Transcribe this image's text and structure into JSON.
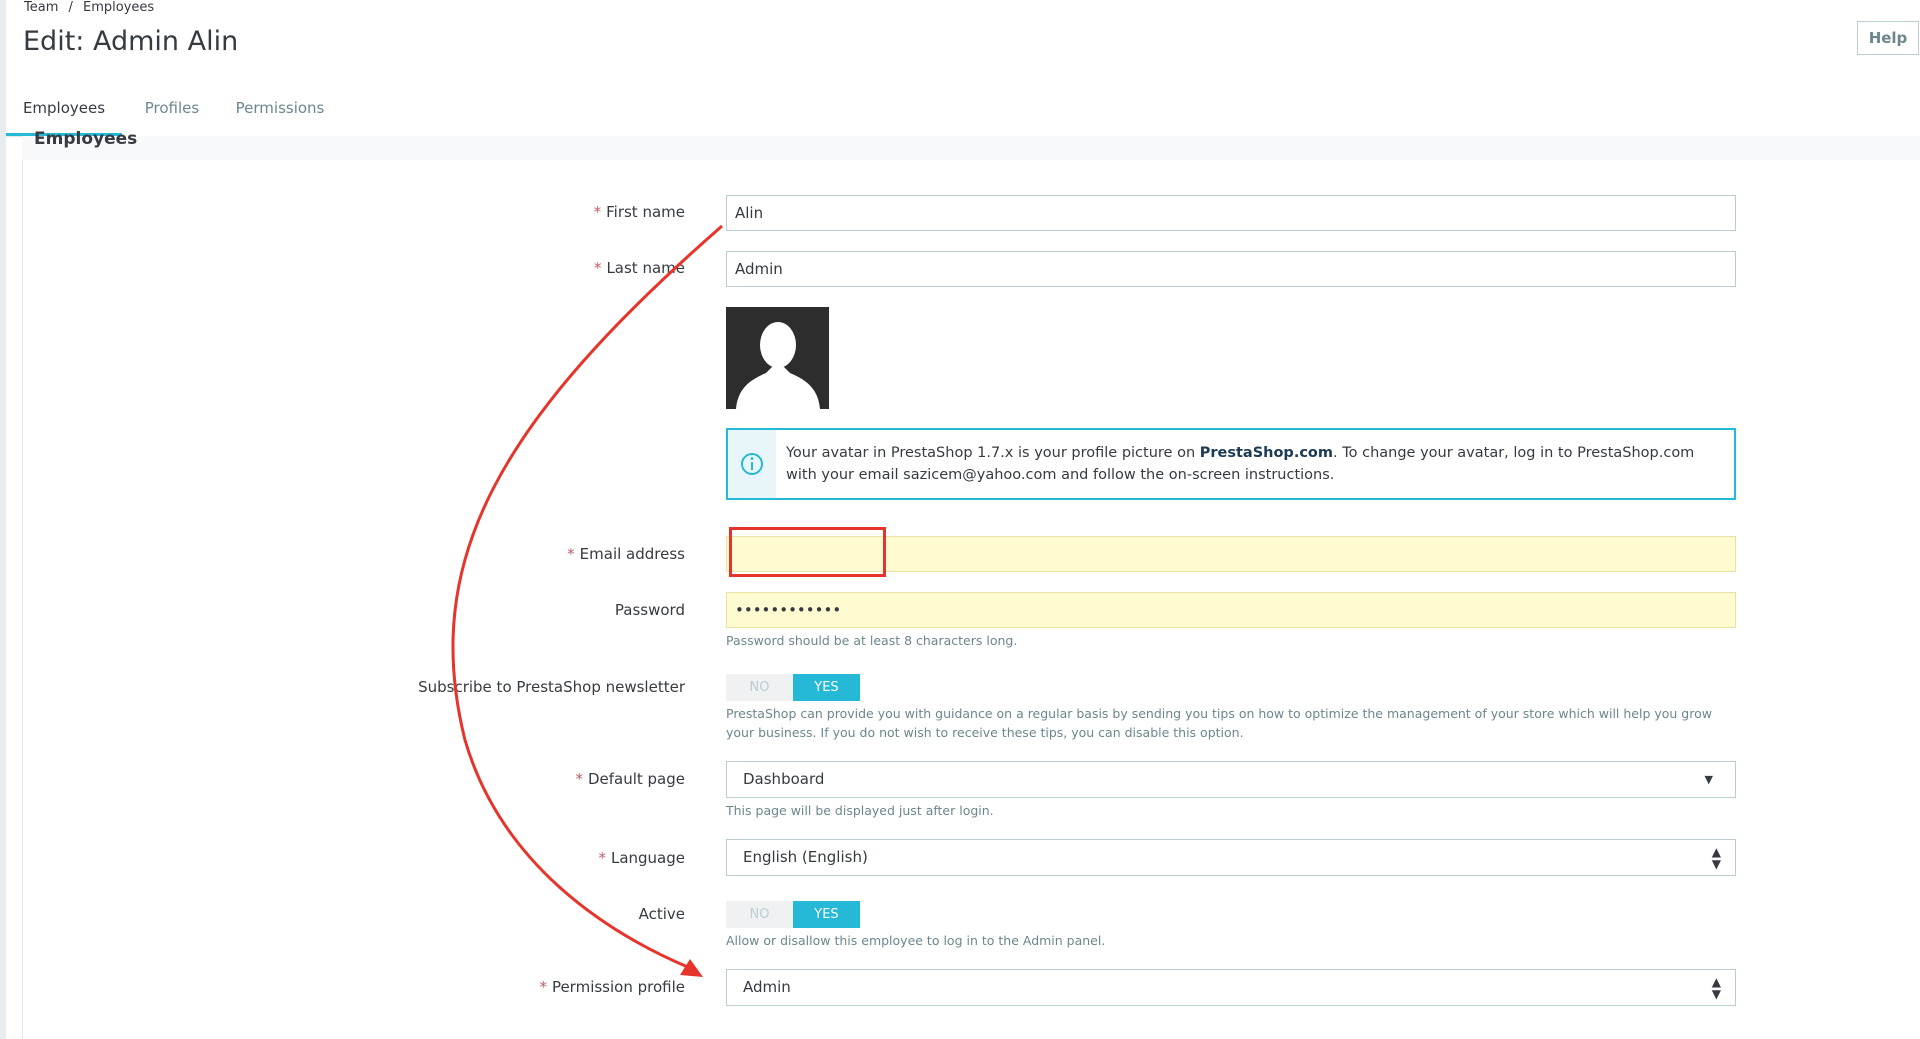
{
  "header": {
    "breadcrumb": [
      "Team",
      "Employees"
    ],
    "breadcrumb_sep": "/",
    "title": "Edit: Admin Alin",
    "help_label": "Help"
  },
  "tabs": [
    {
      "label": "Employees",
      "active": true
    },
    {
      "label": "Profiles",
      "active": false
    },
    {
      "label": "Permissions",
      "active": false
    }
  ],
  "panel": {
    "heading": "Employees"
  },
  "form": {
    "required_marker": "*",
    "first_name": {
      "label": "First name",
      "value": "Alin"
    },
    "last_name": {
      "label": "Last name",
      "value": "Admin"
    },
    "avatar_info": {
      "part1": "Your avatar in PrestaShop 1.7.x is your profile picture on ",
      "link": "PrestaShop.com",
      "part2": ". To change your avatar, log in to PrestaShop.com with your email sazicem@yahoo.com and follow the on-screen instructions."
    },
    "email": {
      "label": "Email address",
      "value": ""
    },
    "password": {
      "label": "Password",
      "value": "••••••••••••",
      "help": "Password should be at least 8 characters long."
    },
    "newsletter": {
      "label": "Subscribe to PrestaShop newsletter",
      "no": "NO",
      "yes": "YES",
      "selected": "YES",
      "help": "PrestaShop can provide you with guidance on a regular basis by sending you tips on how to optimize the management of your store which will help you grow your business. If you do not wish to receive these tips, you can disable this option."
    },
    "default_page": {
      "label": "Default page",
      "value": "Dashboard",
      "help": "This page will be displayed just after login."
    },
    "language": {
      "label": "Language",
      "value": "English (English)"
    },
    "active": {
      "label": "Active",
      "no": "NO",
      "yes": "YES",
      "selected": "YES",
      "help": "Allow or disallow this employee to log in to the Admin panel."
    },
    "permission_profile": {
      "label": "Permission profile",
      "value": "Admin"
    }
  },
  "annotation_color": "#e6342a",
  "accent_color": "#25b9d7"
}
